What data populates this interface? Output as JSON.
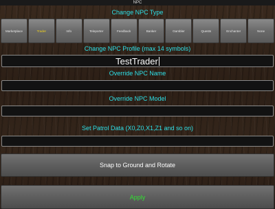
{
  "window": {
    "title": "NPC"
  },
  "type_section": {
    "label": "Change NPC Type",
    "buttons": [
      {
        "label": "Marketplace",
        "selected": false
      },
      {
        "label": "Trader",
        "selected": true
      },
      {
        "label": "Info",
        "selected": false
      },
      {
        "label": "Teleporter",
        "selected": false
      },
      {
        "label": "Feedback",
        "selected": false
      },
      {
        "label": "Banker",
        "selected": false
      },
      {
        "label": "Gambler",
        "selected": false
      },
      {
        "label": "Quests",
        "selected": false
      },
      {
        "label": "Enchanter",
        "selected": false
      },
      {
        "label": "None",
        "selected": false
      }
    ]
  },
  "profile_section": {
    "label": "Change NPC Profile (max 14 symbols)",
    "value": "TestTrader"
  },
  "name_section": {
    "label": "Override NPC Name",
    "value": ""
  },
  "model_section": {
    "label": "Override NPC Model",
    "value": ""
  },
  "patrol_section": {
    "label": "Set Patrol Data (X0,Z0,X1,Z1 and so on)",
    "value": ""
  },
  "actions": {
    "snap_label": "Snap to Ground and Rotate",
    "apply_label": "Apply"
  },
  "colors": {
    "label": "#2ee0e8",
    "selected": "#f2d21a",
    "apply": "#33e033"
  }
}
